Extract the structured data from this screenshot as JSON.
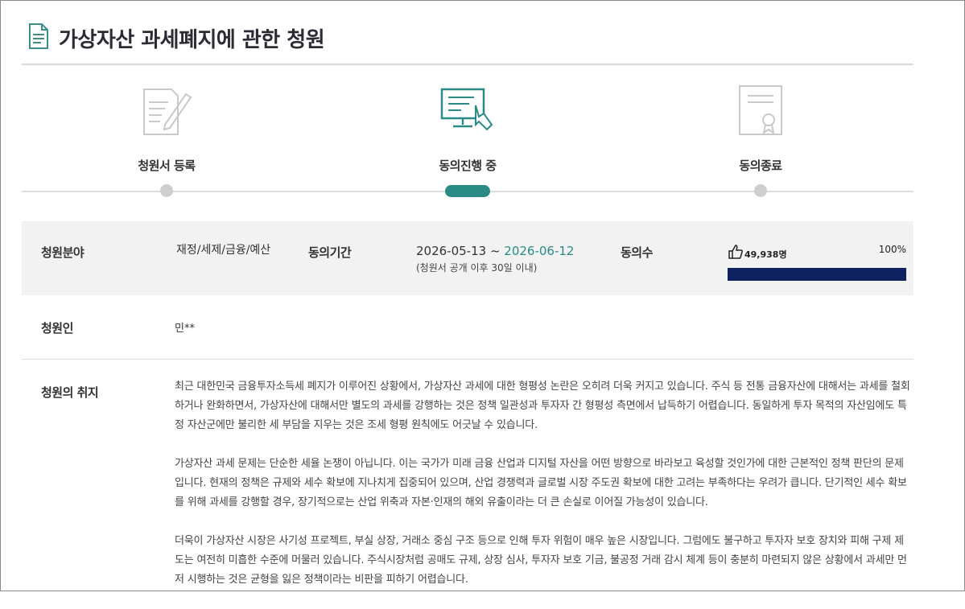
{
  "title": "가상자산 과세폐지에 관한 청원",
  "steps": [
    {
      "label": "청원서 등록",
      "icon": "document-pen-icon"
    },
    {
      "label": "동의진행 중",
      "icon": "monitor-hand-click-icon"
    },
    {
      "label": "동의종료",
      "icon": "certificate-icon"
    }
  ],
  "colors": {
    "accent": "#2a8a86",
    "progress": "#0f2260",
    "row_bg": "#f2f2f2"
  },
  "info": {
    "field_label": "청원분야",
    "field_value": "재정/세제/금융/예산",
    "period_label": "동의기간",
    "period_start": "2026-05-13",
    "period_sep": " ~ ",
    "period_end": "2026-06-12",
    "period_note": "(청원서 공개 이후 30일 이내)",
    "votes_label": "동의수",
    "votes_count": "49,938명",
    "votes_percent": "100%",
    "votes_fraction": 1.0,
    "petitioner_label": "청원인",
    "petitioner_value": "민**",
    "purpose_label": "청원의 취지"
  },
  "purpose_paragraphs": [
    "최근 대한민국 금융투자소득세 폐지가 이루어진 상황에서, 가상자산 과세에 대한 형평성 논란은 오히려 더욱 커지고 있습니다. 주식 등 전통 금융자산에 대해서는 과세를 철회하거나 완화하면서, 가상자산에 대해서만 별도의 과세를 강행하는 것은 정책 일관성과 투자자 간 형평성 측면에서 납득하기 어렵습니다. 동일하게 투자 목적의 자산임에도 특정 자산군에만 불리한 세 부담을 지우는 것은 조세 형평 원칙에도 어긋날 수 있습니다.",
    "가상자산 과세 문제는 단순한 세율 논쟁이 아닙니다. 이는 국가가 미래 금융 산업과 디지털 자산을 어떤 방향으로 바라보고 육성할 것인가에 대한 근본적인 정책 판단의 문제입니다. 현재의 정책은 규제와 세수 확보에 지나치게 집중되어 있으며, 산업 경쟁력과 글로벌 시장 주도권 확보에 대한 고려는 부족하다는 우려가 큽니다. 단기적인 세수 확보를 위해 과세를 강행할 경우, 장기적으로는 산업 위축과 자본·인재의 해외 유출이라는 더 큰 손실로 이어질 가능성이 있습니다.",
    "더욱이 가상자산 시장은 사기성 프로젝트, 부실 상장, 거래소 중심 구조 등으로 인해 투자 위험이 매우 높은 시장입니다. 그럼에도 불구하고 투자자 보호 장치와 피해 구제 제도는 여전히 미흡한 수준에 머물러 있습니다. 주식시장처럼 공매도 규제, 상장 심사, 투자자 보호 기금, 불공정 거래 감시 체계 등이 충분히 마련되지 않은 상황에서 과세만 먼저 시행하는 것은 균형을 잃은 정책이라는 비판을 피하기 어렵습니다."
  ]
}
